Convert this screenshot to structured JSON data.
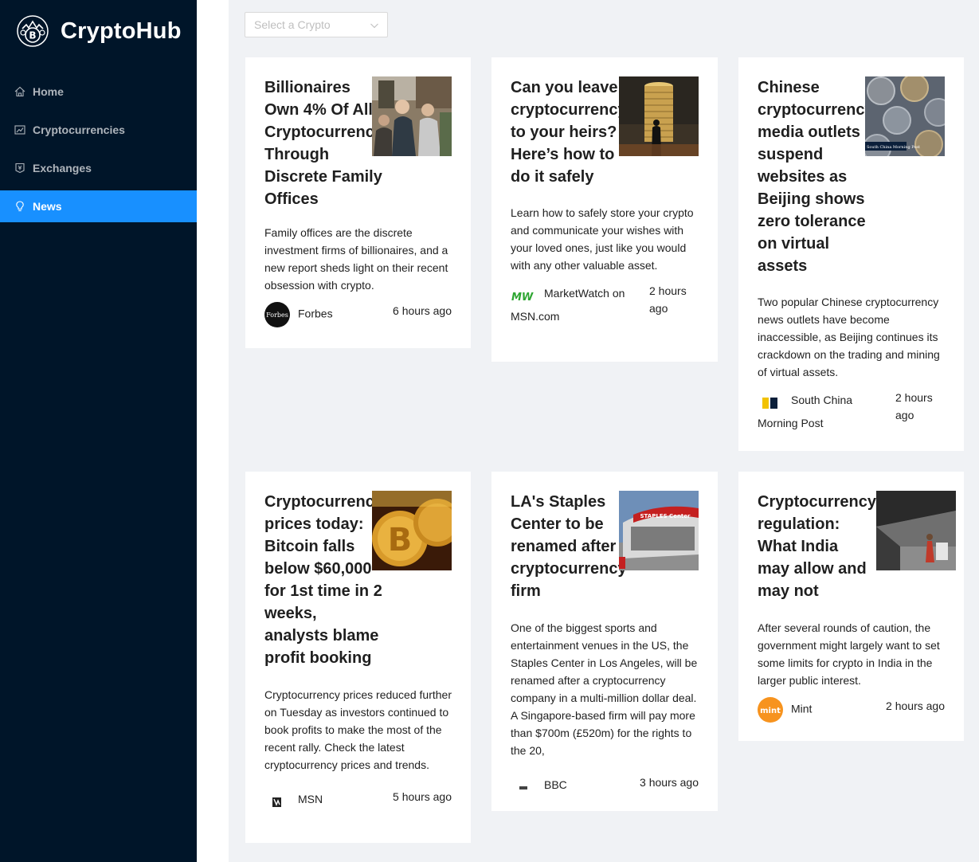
{
  "app": {
    "title": "CryptoHub"
  },
  "sidebar": {
    "items": [
      {
        "label": "Home",
        "icon": "home-icon"
      },
      {
        "label": "Cryptocurrencies",
        "icon": "fund-icon"
      },
      {
        "label": "Exchanges",
        "icon": "money-collect-icon"
      },
      {
        "label": "News",
        "icon": "bulb-icon",
        "active": true
      }
    ]
  },
  "select": {
    "placeholder": "Select a Crypto"
  },
  "colors": {
    "sidebar_bg": "#001529",
    "active": "#1890ff",
    "main_bg": "#f0f2f5"
  },
  "news": [
    {
      "title": "Billionaires Own 4% Of All Cryptocurrency Through Discrete Family Offices",
      "description": "Family offices are the discrete investment firms of billionaires, and a new report sheds light on their recent obsession with crypto.",
      "provider": "Forbes",
      "time": "6 hours ago"
    },
    {
      "title": "Can you leave cryptocurrency to your heirs? Here’s how to do it safely",
      "description": "Learn how to safely store your crypto and communicate your wishes with your loved ones, just like you would with any other valuable asset.",
      "provider": "MarketWatch on MSN.com",
      "time": "2 hours ago"
    },
    {
      "title": "Chinese cryptocurrency media outlets suspend websites as Beijing shows zero tolerance on virtual assets",
      "description": "Two popular Chinese cryptocurrency news outlets have become inaccessible, as Beijing continues its crackdown on the trading and mining of virtual assets.",
      "provider": "South China Morning Post",
      "time": "2 hours ago"
    },
    {
      "title": "Cryptocurrency prices today: Bitcoin falls below $60,000 for 1st time in 2 weeks, analysts blame profit booking",
      "description": "Cryptocurrency prices reduced further on Tuesday as investors continued to book profits to make the most of the recent rally. Check the latest cryptocurrency prices and trends.",
      "provider": "MSN",
      "time": "5 hours ago"
    },
    {
      "title": "LA's Staples Center to be renamed after cryptocurrency firm",
      "description": "One of the biggest sports and entertainment venues in the US, the Staples Center in Los Angeles, will be renamed after a cryptocurrency company in a multi-million dollar deal. A Singapore-based firm will pay more than $700m (£520m) for the rights to the 20,",
      "provider": "BBC",
      "time": "3 hours ago"
    },
    {
      "title": "Cryptocurrency regulation: What India may allow and may not",
      "description": "After several rounds of caution, the government might largely want to set some limits for crypto in India in the larger public interest.",
      "provider": "Mint",
      "time": "2 hours ago"
    }
  ],
  "thumb_text": {
    "scmp": "South China Morning Post",
    "staples": "STAPLES Center"
  },
  "logo_text": {
    "forbes": "Forbes",
    "mw": "MW",
    "mint": "mint"
  }
}
